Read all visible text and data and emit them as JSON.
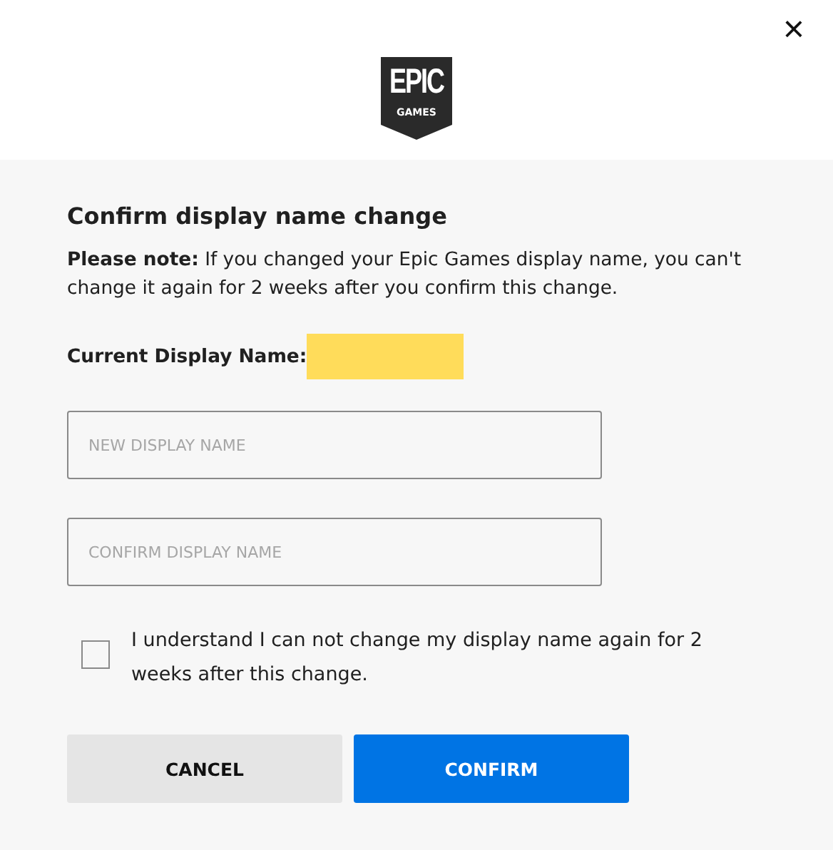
{
  "close_icon": "×",
  "logo": {
    "line_1": "EPIC",
    "line_2": "GAMES"
  },
  "title": "Confirm display name change",
  "note": "**Please note:** If you changed your Epic Games display name, you can't change it again for 2 weeks after you confirm this change.",
  "current_name": {
    "label": "Current Display Name:",
    "redacted": true
  },
  "fields": [
    {
      "placeholder": "NEW DISPLAY NAME"
    },
    {
      "placeholder": "CONFIRM DISPLAY NAME"
    }
  ],
  "agreement": {
    "label": "I understand I can not change my display name again for 2 weeks after this change.",
    "checked": false
  },
  "buttons": [
    {
      "label": "CANCEL",
      "kind": "secondary"
    },
    {
      "label": "CONFIRM",
      "kind": "primary"
    }
  ]
}
